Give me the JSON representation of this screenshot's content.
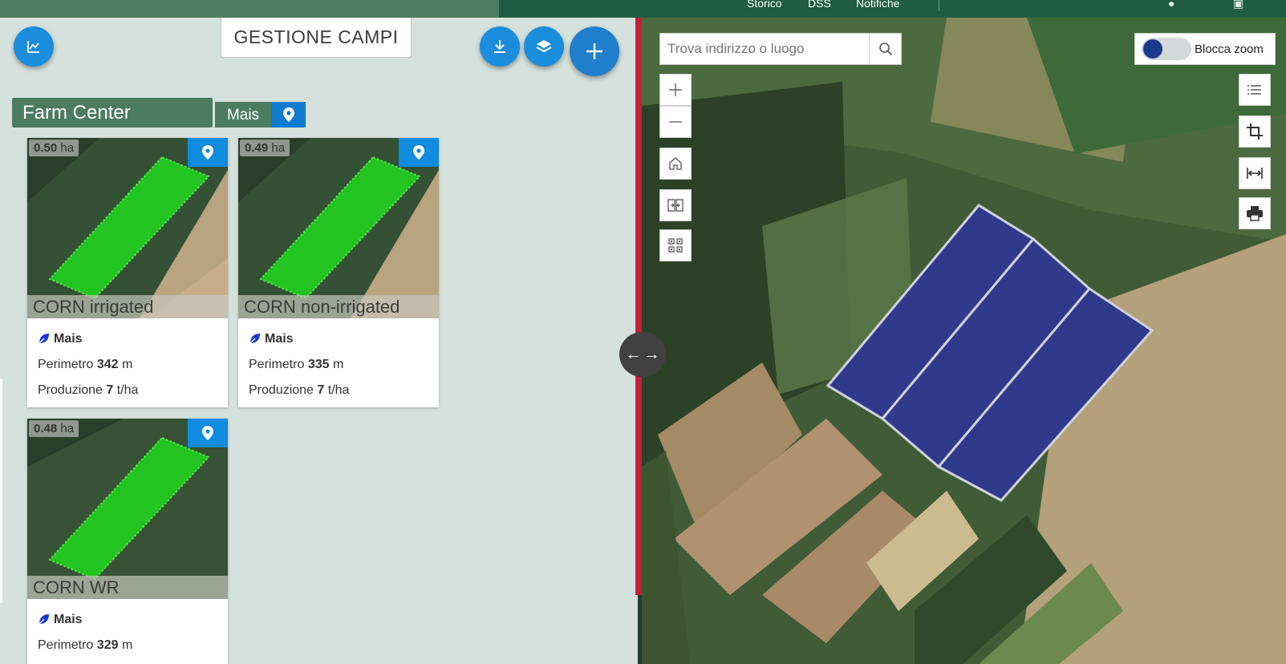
{
  "topnav": {
    "items": [
      "Storico",
      "DSS",
      "Notifiche"
    ]
  },
  "left": {
    "title": "GESTIONE CAMPI",
    "farm_name": "Farm Center",
    "crop_filter": "Mais",
    "fields": [
      {
        "area_value": "0.50",
        "area_unit": "ha",
        "name": "CORN irrigated",
        "crop": "Mais",
        "perimeter_label": "Perimetro",
        "perimeter_value": "342",
        "perimeter_unit": "m",
        "production_label": "Produzione",
        "production_value": "7",
        "production_unit": "t/ha"
      },
      {
        "area_value": "0.49",
        "area_unit": "ha",
        "name": "CORN non-irrigated",
        "crop": "Mais",
        "perimeter_label": "Perimetro",
        "perimeter_value": "335",
        "perimeter_unit": "m",
        "production_label": "Produzione",
        "production_value": "7",
        "production_unit": "t/ha"
      },
      {
        "area_value": "0.48",
        "area_unit": "ha",
        "name": "CORN WR",
        "crop": "Mais",
        "perimeter_label": "Perimetro",
        "perimeter_value": "329",
        "perimeter_unit": "m"
      }
    ]
  },
  "map": {
    "search_placeholder": "Trova indirizzo o luogo",
    "lock_zoom_label": "Blocca zoom",
    "lock_zoom_on": false
  },
  "colors": {
    "header_green": "#1f5c43",
    "brand_green": "#4c7c5f",
    "accent_blue": "#1b8ddd",
    "field_green": "#22c41f",
    "field_highlight": "#2f3a8c",
    "divider_red": "#c3213a"
  },
  "icons": [
    "chart-icon",
    "download-icon",
    "layers-icon",
    "plus-icon",
    "pin-icon",
    "leaf-icon",
    "search-icon",
    "zoom-in-icon",
    "zoom-out-icon",
    "home-icon",
    "swap-icon",
    "qr-icon",
    "list-icon",
    "crop-icon",
    "measure-icon",
    "print-icon",
    "arrow-left-icon",
    "arrow-right-icon"
  ]
}
